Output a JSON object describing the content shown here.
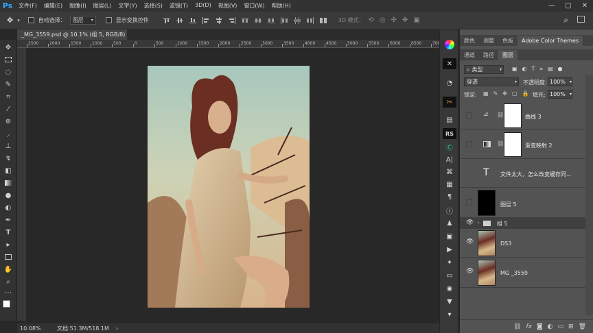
{
  "menubar": {
    "items": [
      "文件(F)",
      "编辑(E)",
      "图像(I)",
      "图层(L)",
      "文字(Y)",
      "选择(S)",
      "滤镜(T)",
      "3D(D)",
      "视图(V)",
      "窗口(W)",
      "帮助(H)"
    ]
  },
  "options": {
    "auto_select_label": "自动选择：",
    "auto_select_value": "图层",
    "show_transform_label": "显示变换控件",
    "mode_3d_label": "3D 模式："
  },
  "document": {
    "tab_title": "_MG_3559.psd @ 10.1% (组 5, RGB/8) *",
    "ruler_ticks": [
      "2500",
      "2000",
      "1500",
      "1000",
      "500",
      "0",
      "500",
      "1000",
      "1500",
      "2000",
      "2500",
      "3000",
      "3500",
      "4000",
      "4500",
      "5000",
      "5500",
      "6000",
      "6500",
      "7000"
    ]
  },
  "status": {
    "zoom": "10.08%",
    "doc_size": "文档:51.3M/518.1M"
  },
  "panels": {
    "top_tabs": [
      "颜色",
      "调整",
      "色板",
      "Adobe Color Themes"
    ],
    "layer_tabs": [
      "通道",
      "路径",
      "图层"
    ],
    "filter_kind": "类型",
    "blend_mode": "穿透",
    "opacity_label": "不透明度:",
    "opacity_value": "100%",
    "lock_label": "锁定:",
    "fill_label": "填充:",
    "fill_value": "100%"
  },
  "layers": [
    {
      "name": "曲线 3",
      "visible": false,
      "kind": "curves"
    },
    {
      "name": "渐变映射 2",
      "visible": false,
      "kind": "gradient-map"
    },
    {
      "name": "文件太大，怎么改变缓存同...",
      "visible": false,
      "kind": "text"
    },
    {
      "name": "图层 5",
      "visible": false,
      "kind": "black"
    },
    {
      "name": "组 5",
      "visible": true,
      "kind": "group"
    },
    {
      "name": "DS3",
      "visible": true,
      "kind": "photo"
    },
    {
      "name": "MG _3559",
      "visible": true,
      "kind": "photo"
    }
  ],
  "colors": {
    "ps_blue": "#31a8ff",
    "panel_bg": "#535353",
    "selected_row": "#3f3f3f"
  }
}
